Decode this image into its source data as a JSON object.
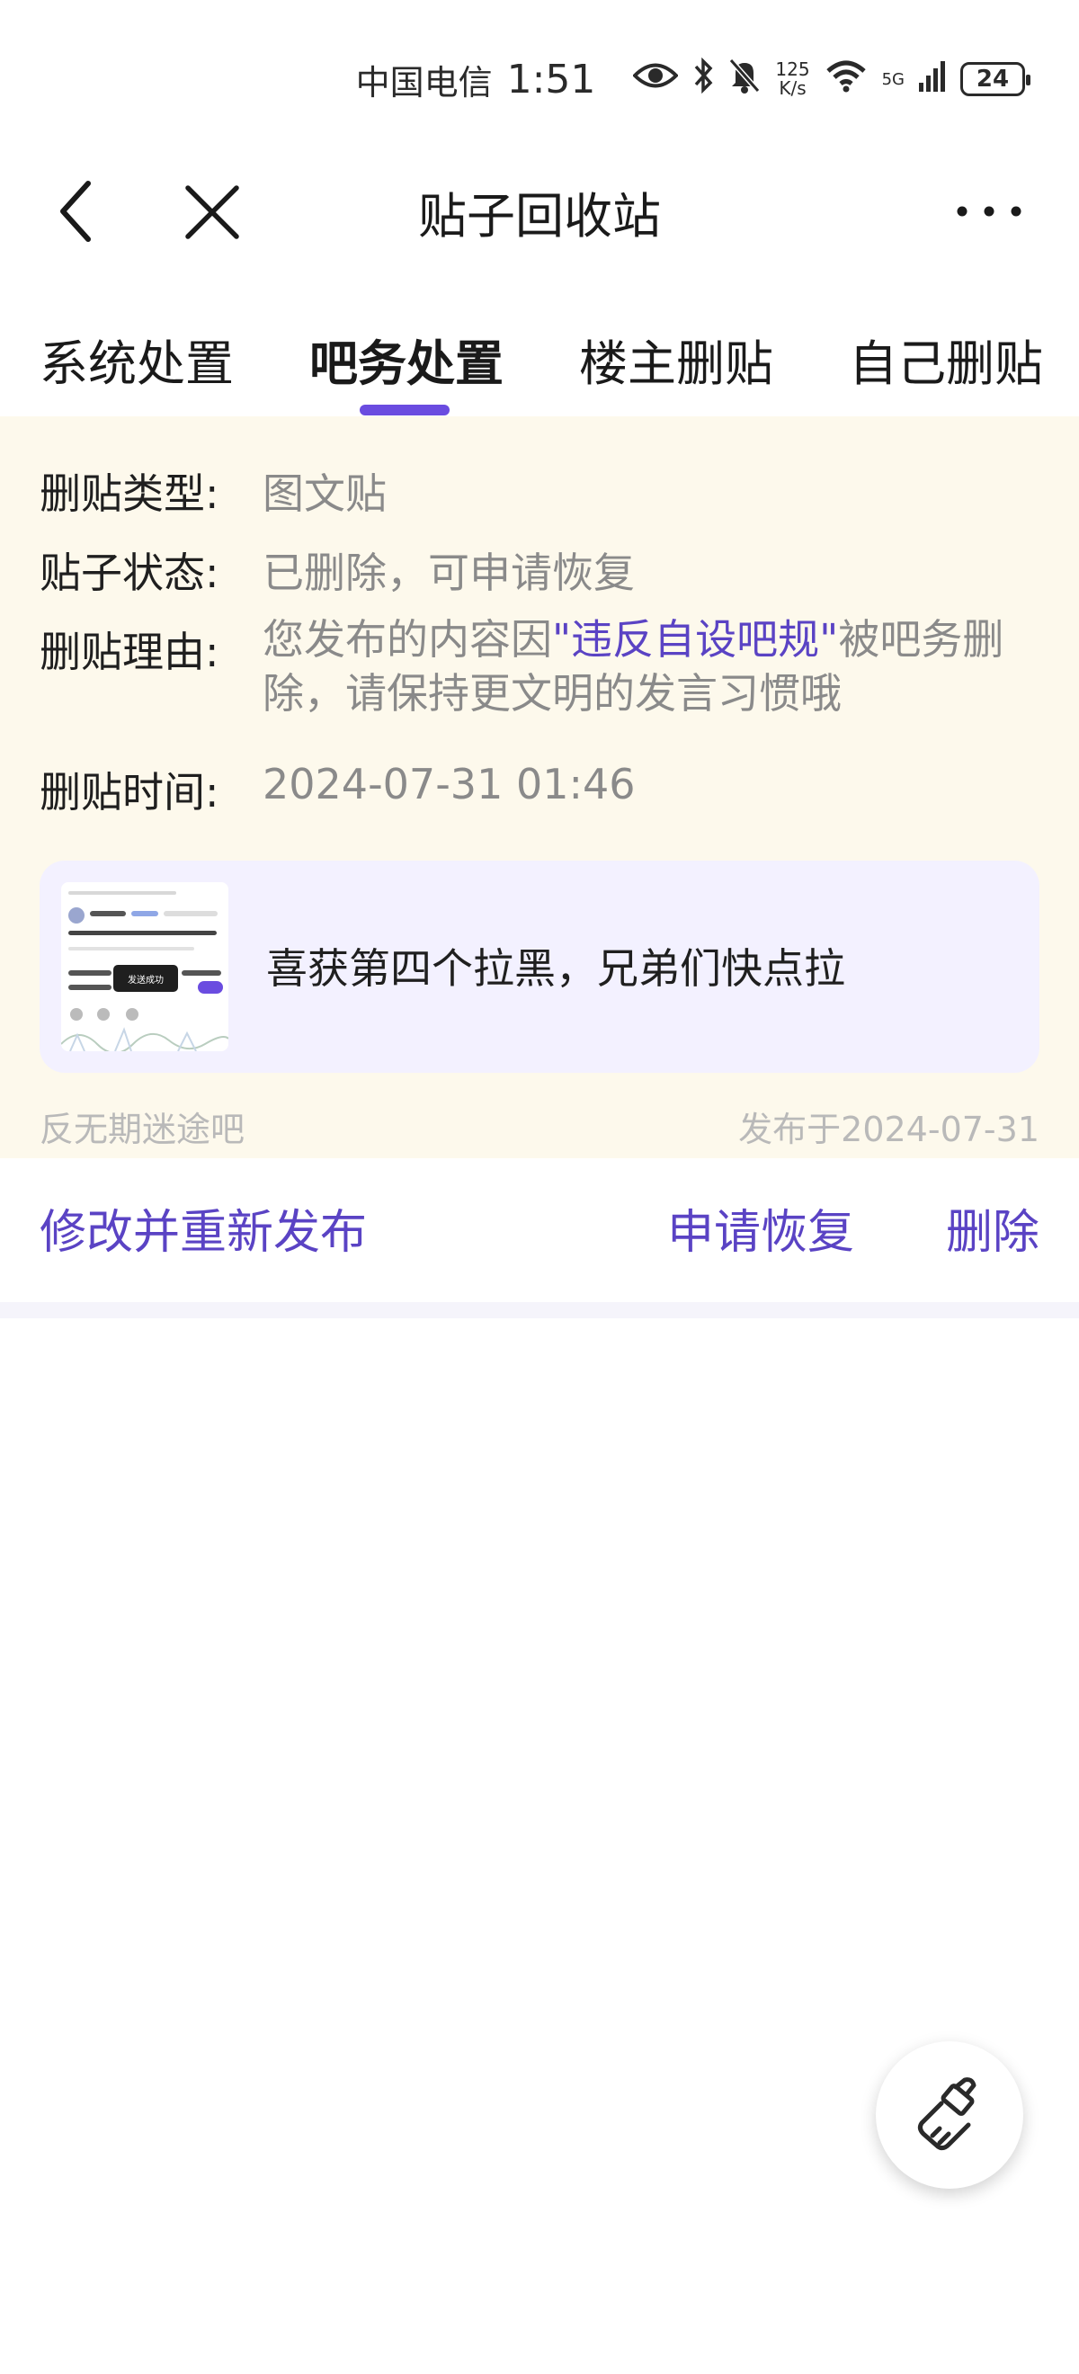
{
  "status_bar": {
    "carrier": "中国电信",
    "time": "1:51",
    "net_speed_value": "125",
    "net_speed_unit": "K/s",
    "network_type": "5G",
    "battery": "24"
  },
  "header": {
    "title": "贴子回收站",
    "back_icon": "chevron-left-icon",
    "close_icon": "close-icon",
    "more_icon": "more-horizontal-icon"
  },
  "tabs": [
    {
      "label": "系统处置",
      "active": false
    },
    {
      "label": "吧务处置",
      "active": true
    },
    {
      "label": "楼主删贴",
      "active": false
    },
    {
      "label": "自己删贴",
      "active": false
    }
  ],
  "accent_color": "#6a4ce0",
  "record": {
    "type_label": "删贴类型:",
    "type_value": "图文贴",
    "status_label": "贴子状态:",
    "status_value": "已删除，可申请恢复",
    "reason_label": "删贴理由:",
    "reason_prefix": "您发布的内容因",
    "reason_highlight": "\"违反自设吧规\"",
    "reason_suffix": "被吧务删除，请保持更文明的发言习惯哦",
    "time_label": "删贴时间:",
    "time_value": "2024-07-31 01:46",
    "preview_text": "喜获第四个拉黑，兄弟们快点拉",
    "thumbnail_caption": "发送成功",
    "forum_name": "反无期迷途吧",
    "post_date": "发布于2024-07-31"
  },
  "actions": {
    "edit_repost": "修改并重新发布",
    "apply_restore": "申请恢复",
    "delete": "删除"
  },
  "fab_icon": "broom-icon"
}
